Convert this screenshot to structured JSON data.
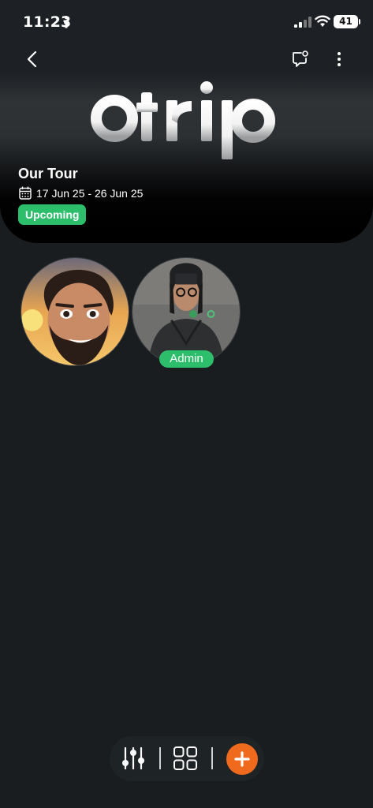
{
  "status_bar": {
    "time": "11:23",
    "battery": "41"
  },
  "header": {
    "logo_text": "otrip"
  },
  "trip": {
    "title": "Our Tour",
    "date_range": "17 Jun 25 - 26 Jun 25",
    "status": "Upcoming"
  },
  "members": [
    {
      "role": ""
    },
    {
      "role": "Admin"
    }
  ],
  "colors": {
    "background": "#191d20",
    "accent_green": "#2dbe6c",
    "accent_orange": "#f06a1d"
  },
  "icons": {
    "back": "chevron-left-icon",
    "chat": "chat-bubble-icon",
    "more": "more-vertical-icon",
    "calendar": "calendar-icon",
    "filter": "sliders-icon",
    "grid": "grid-icon",
    "add": "plus-icon"
  }
}
